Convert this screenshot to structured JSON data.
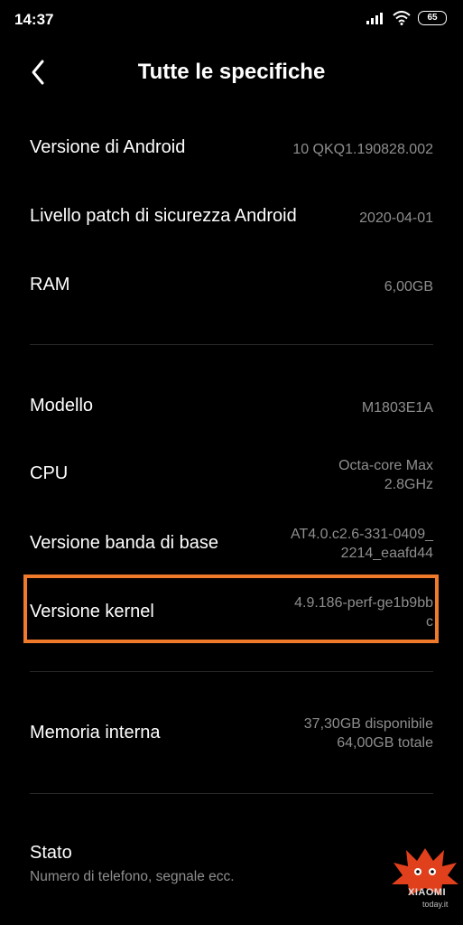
{
  "status_bar": {
    "time": "14:37",
    "battery": "65",
    "icons": [
      "signal-icon",
      "wifi-icon",
      "battery-icon"
    ]
  },
  "header": {
    "title": "Tutte le specifiche",
    "back_icon": "back-arrow-icon"
  },
  "specs": {
    "android_version": {
      "label": "Versione di Android",
      "value": "10 QKQ1.190828.002"
    },
    "security_patch": {
      "label": "Livello patch di sicurezza Android",
      "value": "2020-04-01"
    },
    "ram": {
      "label": "RAM",
      "value": "6,00GB"
    },
    "model": {
      "label": "Modello",
      "value": "M1803E1A"
    },
    "cpu": {
      "label": "CPU",
      "value_line1": "Octa-core Max",
      "value_line2": "2.8GHz"
    },
    "baseband": {
      "label": "Versione banda di base",
      "value_line1": "AT4.0.c2.6-331-0409_",
      "value_line2": "2214_eaafd44"
    },
    "kernel": {
      "label": "Versione kernel",
      "value_line1": "4.9.186-perf-ge1b9bb",
      "value_line2": "c"
    },
    "storage": {
      "label": "Memoria interna",
      "value_line1": "37,30GB disponibile",
      "value_line2": "64,00GB totale"
    }
  },
  "stato": {
    "label": "Stato",
    "subtitle": "Numero di telefono, segnale ecc."
  },
  "highlight_color": "#f07a2c",
  "watermark": {
    "brand": "XIAOMI",
    "sub": "today.it"
  }
}
